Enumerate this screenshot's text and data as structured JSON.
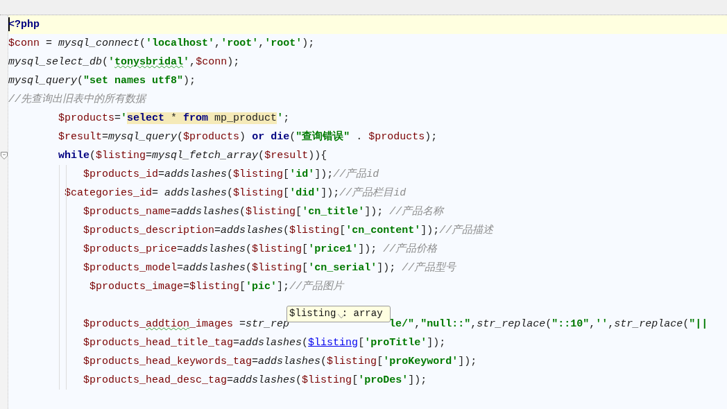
{
  "editor": {
    "lines": [
      {
        "kind": "code",
        "current": true,
        "tokens": [
          {
            "kind": "kw",
            "text": "<?php"
          }
        ]
      },
      {
        "kind": "code",
        "current": false,
        "tokens": [
          {
            "kind": "var",
            "text": "$conn"
          },
          {
            "kind": "p",
            "text": " = "
          },
          {
            "kind": "fn",
            "text": "mysql_connect"
          },
          {
            "kind": "p",
            "text": "("
          },
          {
            "kind": "str",
            "text": "'localhost'"
          },
          {
            "kind": "p",
            "text": ","
          },
          {
            "kind": "str",
            "text": "'root'"
          },
          {
            "kind": "p",
            "text": ","
          },
          {
            "kind": "str",
            "text": "'root'"
          },
          {
            "kind": "p",
            "text": ");"
          }
        ]
      },
      {
        "kind": "code",
        "current": false,
        "tokens": [
          {
            "kind": "fn",
            "text": "mysql_select_db"
          },
          {
            "kind": "p",
            "text": "("
          },
          {
            "kind": "str",
            "text": "'"
          },
          {
            "kind": "str",
            "text": "tonysbridal",
            "misspelled": true
          },
          {
            "kind": "str",
            "text": "'"
          },
          {
            "kind": "p",
            "text": ","
          },
          {
            "kind": "var",
            "text": "$conn"
          },
          {
            "kind": "p",
            "text": ");"
          }
        ]
      },
      {
        "kind": "code",
        "current": false,
        "tokens": [
          {
            "kind": "fn",
            "text": "mysql_query"
          },
          {
            "kind": "p",
            "text": "("
          },
          {
            "kind": "str",
            "text": "\"set names utf8\""
          },
          {
            "kind": "p",
            "text": ");"
          }
        ]
      },
      {
        "kind": "code",
        "current": false,
        "tokens": [
          {
            "kind": "cm",
            "text": "//先查询出旧表中的所有数据"
          }
        ]
      },
      {
        "kind": "code",
        "current": false,
        "tokens": [
          {
            "kind": "var",
            "text": "        $products"
          },
          {
            "kind": "p",
            "text": "="
          },
          {
            "kind": "str",
            "text": "'"
          },
          {
            "kind": "sqlkw",
            "text": "select"
          },
          {
            "kind": "sqlp",
            "text": " * "
          },
          {
            "kind": "sqlkw",
            "text": "from"
          },
          {
            "kind": "sqlp",
            "text": " mp_product"
          },
          {
            "kind": "str",
            "text": "'"
          },
          {
            "kind": "p",
            "text": ";"
          }
        ]
      },
      {
        "kind": "code",
        "current": false,
        "tokens": [
          {
            "kind": "var",
            "text": "        $result"
          },
          {
            "kind": "p",
            "text": "="
          },
          {
            "kind": "fn",
            "text": "mysql_query"
          },
          {
            "kind": "p",
            "text": "("
          },
          {
            "kind": "var",
            "text": "$products"
          },
          {
            "kind": "p",
            "text": ") "
          },
          {
            "kind": "kw",
            "text": "or die"
          },
          {
            "kind": "p",
            "text": "("
          },
          {
            "kind": "str",
            "text": "\"查询错误\""
          },
          {
            "kind": "p",
            "text": " . "
          },
          {
            "kind": "var",
            "text": "$products"
          },
          {
            "kind": "p",
            "text": ");"
          }
        ]
      },
      {
        "kind": "code",
        "current": false,
        "fold": true,
        "tokens": [
          {
            "kind": "kw",
            "text": "        while"
          },
          {
            "kind": "p",
            "text": "("
          },
          {
            "kind": "var",
            "text": "$listing"
          },
          {
            "kind": "p",
            "text": "="
          },
          {
            "kind": "fn",
            "text": "mysql_fetch_array"
          },
          {
            "kind": "p",
            "text": "("
          },
          {
            "kind": "var",
            "text": "$result"
          },
          {
            "kind": "p",
            "text": ")){"
          }
        ]
      },
      {
        "kind": "code",
        "current": false,
        "tokens": [
          {
            "kind": "var",
            "text": "            $products_id"
          },
          {
            "kind": "p",
            "text": "="
          },
          {
            "kind": "fn",
            "text": "addslashes"
          },
          {
            "kind": "p",
            "text": "("
          },
          {
            "kind": "var",
            "text": "$listing"
          },
          {
            "kind": "p",
            "text": "["
          },
          {
            "kind": "str",
            "text": "'id'"
          },
          {
            "kind": "p",
            "text": "]);"
          },
          {
            "kind": "cm",
            "text": "//产品id"
          }
        ]
      },
      {
        "kind": "code",
        "current": false,
        "tokens": [
          {
            "kind": "var",
            "text": "         $categories_id"
          },
          {
            "kind": "p",
            "text": "= "
          },
          {
            "kind": "fn",
            "text": "addslashes"
          },
          {
            "kind": "p",
            "text": "("
          },
          {
            "kind": "var",
            "text": "$listing"
          },
          {
            "kind": "p",
            "text": "["
          },
          {
            "kind": "str",
            "text": "'did'"
          },
          {
            "kind": "p",
            "text": "]);"
          },
          {
            "kind": "cm",
            "text": "//产品栏目id"
          }
        ]
      },
      {
        "kind": "code",
        "current": false,
        "tokens": [
          {
            "kind": "var",
            "text": "            $products_name"
          },
          {
            "kind": "p",
            "text": "="
          },
          {
            "kind": "fn",
            "text": "addslashes"
          },
          {
            "kind": "p",
            "text": "("
          },
          {
            "kind": "var",
            "text": "$listing"
          },
          {
            "kind": "p",
            "text": "["
          },
          {
            "kind": "str",
            "text": "'cn_title'"
          },
          {
            "kind": "p",
            "text": "]); "
          },
          {
            "kind": "cm",
            "text": "//产品名称"
          }
        ]
      },
      {
        "kind": "code",
        "current": false,
        "tokens": [
          {
            "kind": "var",
            "text": "            $products_description"
          },
          {
            "kind": "p",
            "text": "="
          },
          {
            "kind": "fn",
            "text": "addslashes"
          },
          {
            "kind": "p",
            "text": "("
          },
          {
            "kind": "var",
            "text": "$listing"
          },
          {
            "kind": "p",
            "text": "["
          },
          {
            "kind": "str",
            "text": "'cn_content'"
          },
          {
            "kind": "p",
            "text": "]);"
          },
          {
            "kind": "cm",
            "text": "//产品描述"
          }
        ]
      },
      {
        "kind": "code",
        "current": false,
        "tokens": [
          {
            "kind": "var",
            "text": "            $products_price"
          },
          {
            "kind": "p",
            "text": "="
          },
          {
            "kind": "fn",
            "text": "addslashes"
          },
          {
            "kind": "p",
            "text": "("
          },
          {
            "kind": "var",
            "text": "$listing"
          },
          {
            "kind": "p",
            "text": "["
          },
          {
            "kind": "str",
            "text": "'price1'"
          },
          {
            "kind": "p",
            "text": "]); "
          },
          {
            "kind": "cm",
            "text": "//产品价格"
          }
        ]
      },
      {
        "kind": "code",
        "current": false,
        "tokens": [
          {
            "kind": "var",
            "text": "            $products_model"
          },
          {
            "kind": "p",
            "text": "="
          },
          {
            "kind": "fn",
            "text": "addslashes"
          },
          {
            "kind": "p",
            "text": "("
          },
          {
            "kind": "var",
            "text": "$listing"
          },
          {
            "kind": "p",
            "text": "["
          },
          {
            "kind": "str",
            "text": "'cn_serial'"
          },
          {
            "kind": "p",
            "text": "]); "
          },
          {
            "kind": "cm",
            "text": "//产品型号"
          }
        ]
      },
      {
        "kind": "code",
        "current": false,
        "tokens": [
          {
            "kind": "var",
            "text": "             $products_image"
          },
          {
            "kind": "p",
            "text": "="
          },
          {
            "kind": "var",
            "text": "$listing"
          },
          {
            "kind": "p",
            "text": "["
          },
          {
            "kind": "str",
            "text": "'pic'"
          },
          {
            "kind": "p",
            "text": "];"
          },
          {
            "kind": "cm",
            "text": "//产品图片"
          }
        ]
      },
      {
        "kind": "blank",
        "current": false
      },
      {
        "kind": "split",
        "current": false,
        "tokens": [
          {
            "kind": "var",
            "text": "            $products_"
          },
          {
            "kind": "var",
            "text": "addtion",
            "misspelled": true
          },
          {
            "kind": "var",
            "text": "_images"
          },
          {
            "kind": "p",
            "text": " ="
          },
          {
            "kind": "fn",
            "text": "str_rep"
          }
        ],
        "tooltip": "$listing : array",
        "tokens_after": [
          {
            "kind": "str",
            "text": "le/\""
          },
          {
            "kind": "p",
            "text": ","
          },
          {
            "kind": "str",
            "text": "\"null::\""
          },
          {
            "kind": "p",
            "text": ","
          },
          {
            "kind": "fn",
            "text": "str_replace"
          },
          {
            "kind": "p",
            "text": "("
          },
          {
            "kind": "str",
            "text": "\"::10\""
          },
          {
            "kind": "p",
            "text": ","
          },
          {
            "kind": "str",
            "text": "''"
          },
          {
            "kind": "p",
            "text": ","
          },
          {
            "kind": "fn",
            "text": "str_replace"
          },
          {
            "kind": "p",
            "text": "("
          },
          {
            "kind": "str",
            "text": "\"||"
          }
        ]
      },
      {
        "kind": "code",
        "current": false,
        "tokens": [
          {
            "kind": "var",
            "text": "            $products_head_title_tag"
          },
          {
            "kind": "p",
            "text": "="
          },
          {
            "kind": "fn",
            "text": "addslashes"
          },
          {
            "kind": "p",
            "text": "("
          },
          {
            "kind": "link",
            "text": "$listing"
          },
          {
            "kind": "p",
            "text": "["
          },
          {
            "kind": "str",
            "text": "'proTitle'"
          },
          {
            "kind": "p",
            "text": "]);"
          }
        ]
      },
      {
        "kind": "code",
        "current": false,
        "tokens": [
          {
            "kind": "var",
            "text": "            $products_head_keywords_tag"
          },
          {
            "kind": "p",
            "text": "="
          },
          {
            "kind": "fn",
            "text": "addslashes"
          },
          {
            "kind": "p",
            "text": "("
          },
          {
            "kind": "var",
            "text": "$listing"
          },
          {
            "kind": "p",
            "text": "["
          },
          {
            "kind": "str",
            "text": "'proKeyword'"
          },
          {
            "kind": "p",
            "text": "]);"
          }
        ]
      },
      {
        "kind": "code",
        "current": false,
        "tokens": [
          {
            "kind": "var",
            "text": "            $products_head_desc_tag"
          },
          {
            "kind": "p",
            "text": "="
          },
          {
            "kind": "fn",
            "text": "addslashes"
          },
          {
            "kind": "p",
            "text": "("
          },
          {
            "kind": "var",
            "text": "$listing"
          },
          {
            "kind": "p",
            "text": "["
          },
          {
            "kind": "str",
            "text": "'proDes'"
          },
          {
            "kind": "p",
            "text": "]);"
          }
        ]
      }
    ]
  }
}
